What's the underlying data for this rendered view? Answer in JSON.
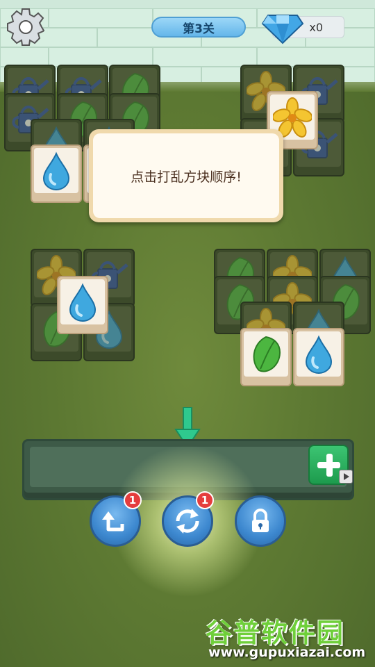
{
  "header": {
    "level_label": "第3关",
    "gem_count": "x0"
  },
  "dialog": {
    "message": "点击打乱方块顺序!"
  },
  "tools": {
    "undo": {
      "badge": "1"
    },
    "shuffle": {
      "badge": "1"
    },
    "lock": {
      "badge": ""
    }
  },
  "watermark": {
    "title": "谷普软件园",
    "url": "www.gupuxiazai.com"
  },
  "icons": [
    "gear-icon",
    "diamond-icon",
    "drop-icon",
    "leaf-icon",
    "flower-icon",
    "watering-can-icon",
    "arrow-down-icon",
    "plus-icon",
    "video-icon",
    "undo-icon",
    "shuffle-icon",
    "lock-icon"
  ],
  "colors": {
    "tray": "#3d5a47",
    "tool_blue": "#3d88cf",
    "badge_red": "#e53d3d",
    "plus_green": "#1d9b4d"
  }
}
